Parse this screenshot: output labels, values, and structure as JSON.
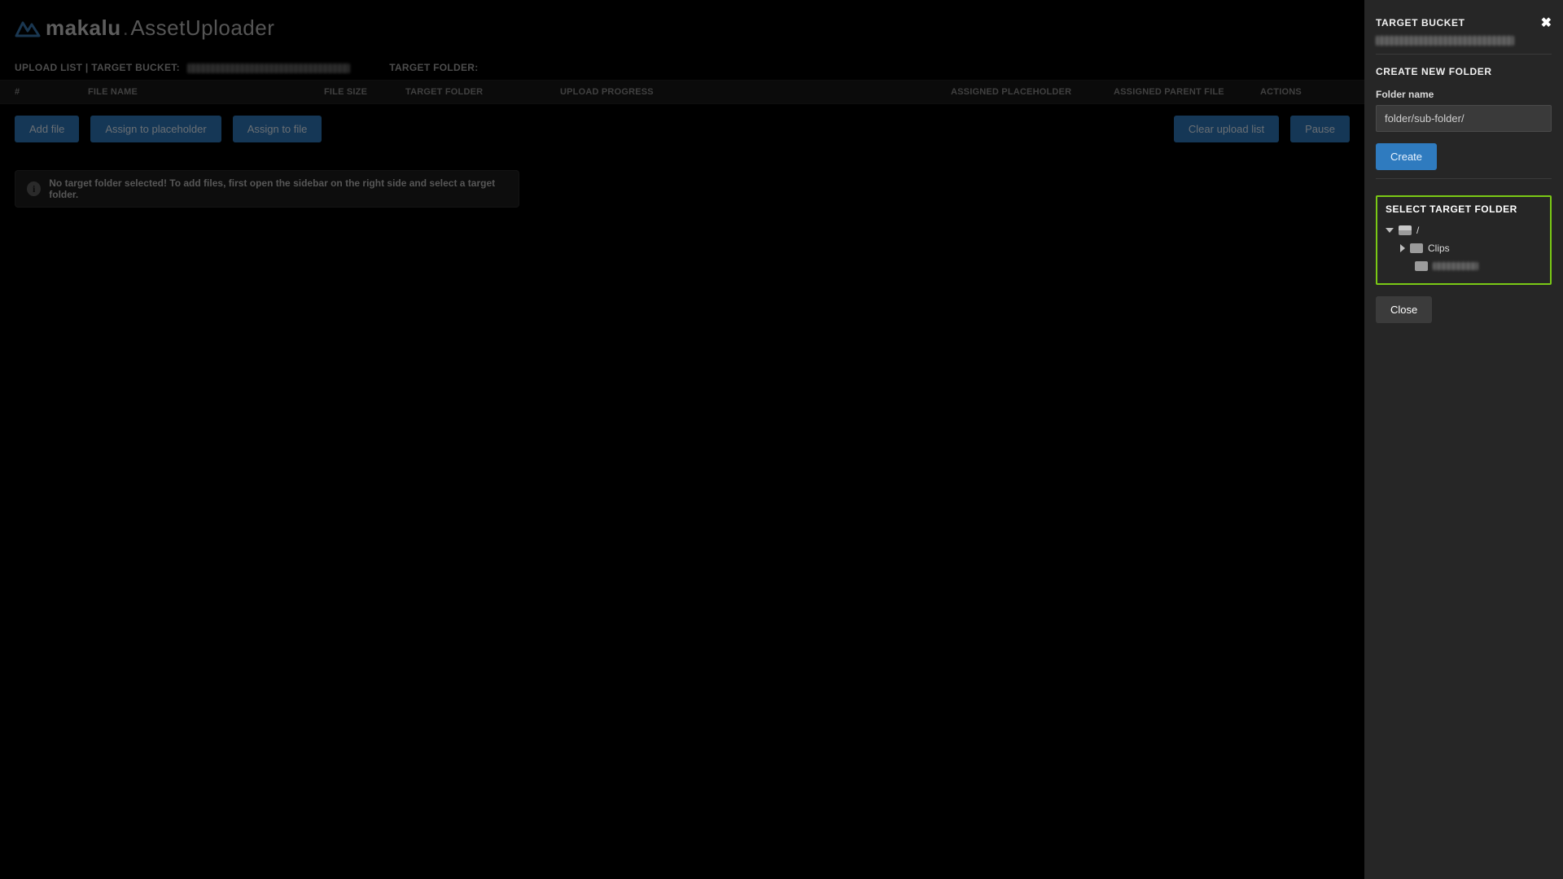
{
  "logo": {
    "brand": "makalu",
    "dot": ".",
    "app": "AssetUploader"
  },
  "contextbar": {
    "upload_list_label": "UPLOAD LIST | TARGET BUCKET:",
    "target_folder_label": "TARGET FOLDER:"
  },
  "columns": {
    "index": "#",
    "file_name": "FILE NAME",
    "file_size": "FILE SIZE",
    "target_folder": "TARGET FOLDER",
    "upload_progress": "UPLOAD PROGRESS",
    "assigned_placeholder": "ASSIGNED PLACEHOLDER",
    "assigned_parent_file": "ASSIGNED PARENT FILE",
    "actions": "ACTIONS"
  },
  "toolbar": {
    "add_file": "Add file",
    "assign_placeholder": "Assign to placeholder",
    "assign_file": "Assign to file",
    "clear_list": "Clear upload list",
    "pause": "Pause"
  },
  "banner": {
    "text": "No target folder selected! To add files, first open the sidebar on the right side and select a target folder."
  },
  "sidebar": {
    "target_bucket_title": "TARGET BUCKET",
    "create_folder_title": "CREATE NEW FOLDER",
    "folder_name_label": "Folder name",
    "folder_name_placeholder": "folder/sub-folder/",
    "create_btn": "Create",
    "select_target_title": "SELECT TARGET FOLDER",
    "tree": {
      "root": "/",
      "child1": "Clips",
      "child2_redacted": true
    },
    "close_btn": "Close"
  }
}
